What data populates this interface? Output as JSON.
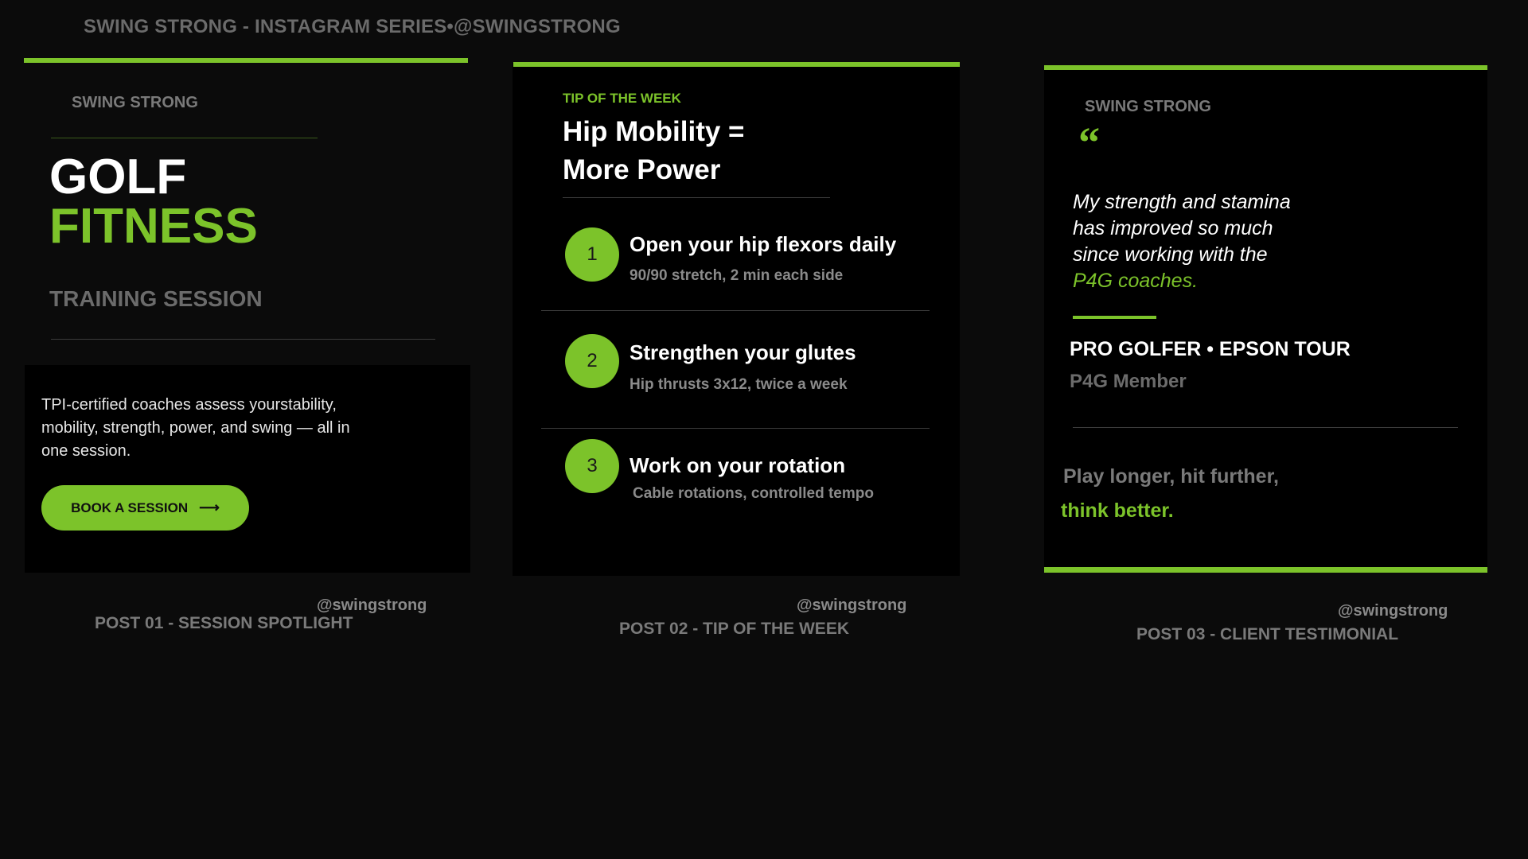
{
  "header": {
    "title": "SWING STRONG - INSTAGRAM SERIES•@SWINGSTRONG"
  },
  "colors": {
    "accent": "#7cc32a",
    "background": "#0b0b0b",
    "card": "#000000",
    "muted": "#6b6b6b"
  },
  "post1": {
    "brand": "SWING STRONG",
    "headline_line1": "GOLF",
    "headline_line2": "FITNESS",
    "subheading": "TRAINING SESSION",
    "description": "TPI-certified coaches assess yourstability, mobility, strength, power, and swing — all in one session.",
    "button_label": "BOOK A SESSION",
    "button_icon": "arrow-right-icon",
    "handle": "@swingstrong",
    "label": "POST 01 - SESSION SPOTLIGHT"
  },
  "post2": {
    "kicker": "TIP OF THE WEEK",
    "title_line1": "Hip Mobility =",
    "title_line2": "More Power",
    "tips": [
      {
        "number": "1",
        "title": "Open your hip flexors daily",
        "detail": "90/90 stretch, 2 min each side"
      },
      {
        "number": "2",
        "title": "Strengthen your glutes",
        "detail": "Hip thrusts 3x12, twice a week"
      },
      {
        "number": "3",
        "title": "Work on your rotation",
        "detail": "Cable rotations, controlled tempo"
      }
    ],
    "handle": "@swingstrong",
    "label": "POST 02 - TIP OF THE WEEK"
  },
  "post3": {
    "brand": "SWING STRONG",
    "quote_mark": "“",
    "quote_line1": "My strength and stamina",
    "quote_line2": "has improved so much",
    "quote_line3": "since working with the",
    "quote_highlight": "P4G coaches.",
    "name": "PRO GOLFER • EPSON TOUR",
    "role": "P4G Member",
    "tagline_line1": "Play longer, hit further,",
    "tagline_line2": "think better.",
    "handle": "@swingstrong",
    "label": "POST 03 - CLIENT TESTIMONIAL"
  }
}
